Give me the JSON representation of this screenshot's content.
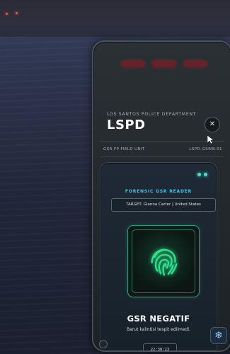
{
  "header": {
    "department": "LOS SANTOS POLICE DEPARTMENT",
    "brand": "LSPD",
    "close_icon": "close-icon"
  },
  "unit_strip": {
    "left": "GSR FP FIELD UNIT",
    "right": "LSPD-GSRW-01"
  },
  "reader": {
    "title": "FORENSIC GSR READER",
    "target": "TARGET: Gianna Carter | United States",
    "status_dots": 2,
    "icon": "fingerprint-icon",
    "result_title": "GSR NEGATIF",
    "result_text": "Barut kalintisi tespit edilmedi.",
    "time": "22:30:23"
  },
  "colors": {
    "accent": "#39c7ee",
    "scanner": "#2fe08c",
    "led": "#6d1f27"
  }
}
